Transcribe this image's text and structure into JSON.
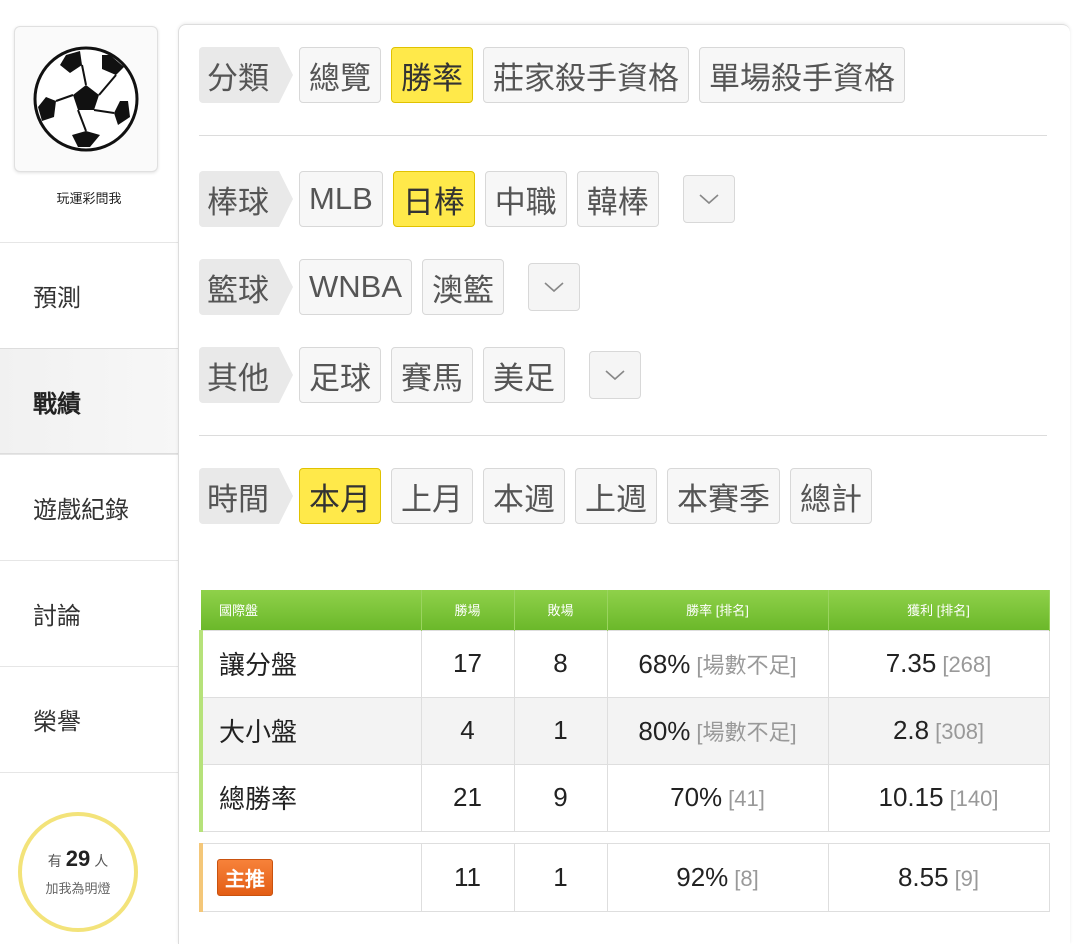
{
  "sidebar": {
    "username": "玩運彩問我",
    "nav": [
      "預測",
      "戰績",
      "遊戲紀錄",
      "討論",
      "榮譽"
    ],
    "active_index": 1,
    "fans": {
      "prefix": "有",
      "count": "29",
      "suffix": "人",
      "caption": "加我為明燈"
    }
  },
  "filters": {
    "category": {
      "label": "分類",
      "options": [
        "總覽",
        "勝率",
        "莊家殺手資格",
        "單場殺手資格"
      ],
      "selected": "勝率"
    },
    "baseball": {
      "label": "棒球",
      "options": [
        "MLB",
        "日棒",
        "中職",
        "韓棒"
      ],
      "selected": "日棒"
    },
    "basketball": {
      "label": "籃球",
      "options": [
        "WNBA",
        "澳籃"
      ]
    },
    "other": {
      "label": "其他",
      "options": [
        "足球",
        "賽馬",
        "美足"
      ]
    },
    "time": {
      "label": "時間",
      "options": [
        "本月",
        "上月",
        "本週",
        "上週",
        "本賽季",
        "總計"
      ],
      "selected": "本月"
    }
  },
  "table": {
    "headers": [
      "國際盤",
      "勝場",
      "敗場",
      "勝率 [排名]",
      "獲利 [排名]"
    ],
    "rows": [
      {
        "name": "讓分盤",
        "wins": "17",
        "losses": "8",
        "rate": "68%",
        "rate_note": "[場數不足]",
        "profit": "7.35",
        "profit_rank": "[268]"
      },
      {
        "name": "大小盤",
        "wins": "4",
        "losses": "1",
        "rate": "80%",
        "rate_note": "[場數不足]",
        "profit": "2.8",
        "profit_rank": "[308]"
      },
      {
        "name": "總勝率",
        "wins": "21",
        "losses": "9",
        "rate": "70%",
        "rate_note": "[41]",
        "profit": "10.15",
        "profit_rank": "[140]"
      }
    ],
    "featured": {
      "badge": "主推",
      "wins": "11",
      "losses": "1",
      "rate": "92%",
      "rate_note": "[8]",
      "profit": "8.55",
      "profit_rank": "[9]"
    }
  },
  "colors": {
    "selected_chip": "#ffe94a",
    "header_green": "#7cc23a",
    "badge_orange": "#f07028"
  }
}
